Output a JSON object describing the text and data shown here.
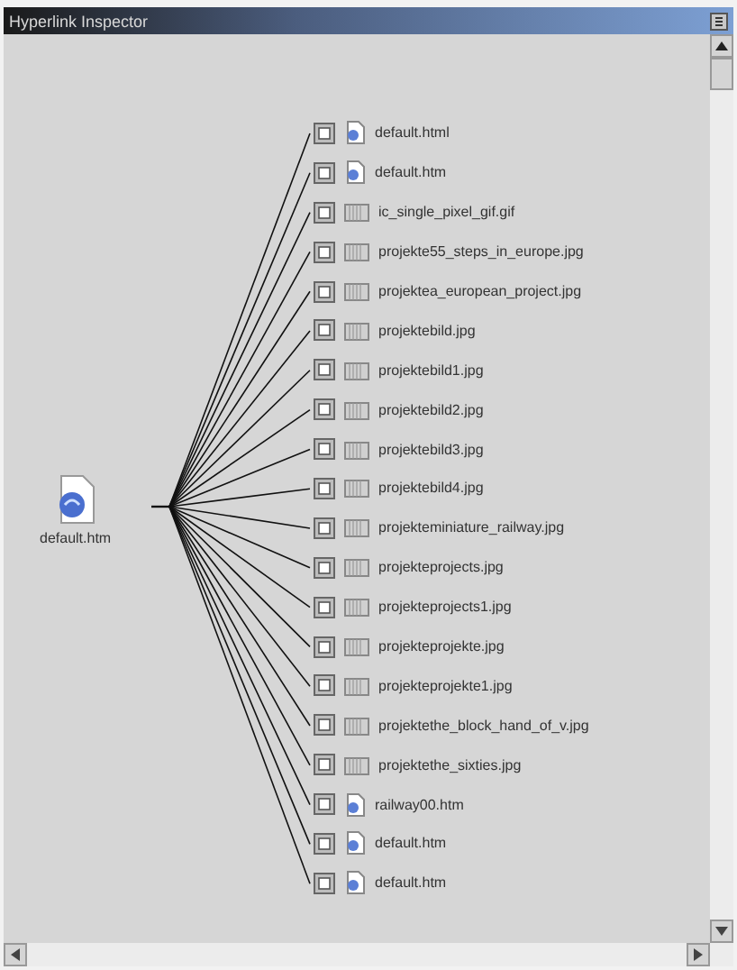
{
  "window": {
    "title": "Hyperlink Inspector"
  },
  "root": {
    "label": "default.htm",
    "kind": "page"
  },
  "links": [
    {
      "label": "default.html",
      "kind": "page"
    },
    {
      "label": "default.htm",
      "kind": "page"
    },
    {
      "label": "ic_single_pixel_gif.gif",
      "kind": "image"
    },
    {
      "label": "projekte55_steps_in_europe.jpg",
      "kind": "image"
    },
    {
      "label": "projektea_european_project.jpg",
      "kind": "image"
    },
    {
      "label": "projektebild.jpg",
      "kind": "image"
    },
    {
      "label": "projektebild1.jpg",
      "kind": "image"
    },
    {
      "label": "projektebild2.jpg",
      "kind": "image"
    },
    {
      "label": "projektebild3.jpg",
      "kind": "image"
    },
    {
      "label": "projektebild4.jpg",
      "kind": "image"
    },
    {
      "label": "projekteminiature_railway.jpg",
      "kind": "image"
    },
    {
      "label": "projekteprojects.jpg",
      "kind": "image"
    },
    {
      "label": "projekteprojects1.jpg",
      "kind": "image"
    },
    {
      "label": "projekteprojekte.jpg",
      "kind": "image"
    },
    {
      "label": "projekteprojekte1.jpg",
      "kind": "image"
    },
    {
      "label": "projektethe_block_hand_of_v.jpg",
      "kind": "image"
    },
    {
      "label": "projektethe_sixties.jpg",
      "kind": "image"
    },
    {
      "label": "railway00.htm",
      "kind": "page"
    },
    {
      "label": "default.htm",
      "kind": "page"
    },
    {
      "label": "default.htm",
      "kind": "page"
    }
  ]
}
